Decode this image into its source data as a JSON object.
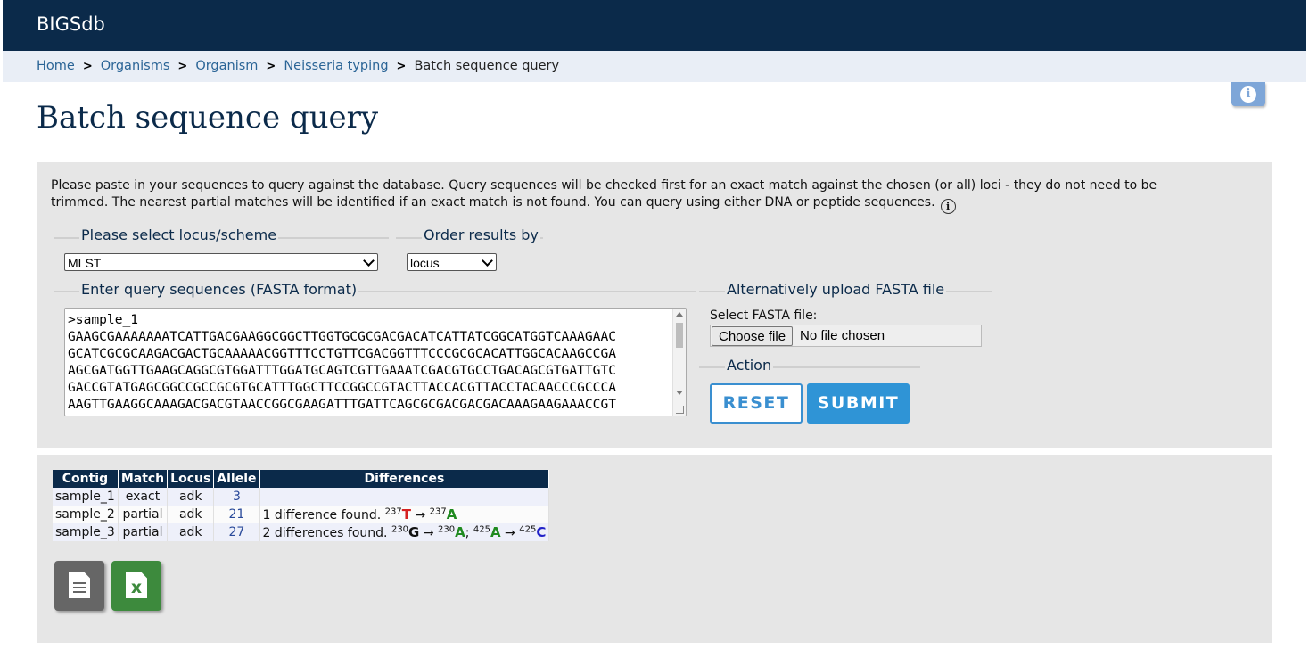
{
  "app": {
    "brand": "BIGSdb"
  },
  "breadcrumb": [
    {
      "label": "Home"
    },
    {
      "label": "Organisms"
    },
    {
      "label": "Organism"
    },
    {
      "label": "Neisseria typing"
    }
  ],
  "breadcrumb_current": "Batch sequence query",
  "breadcrumb_separator": ">",
  "page_title": "Batch sequence query",
  "intro_text": "Please paste in your sequences to query against the database. Query sequences will be checked first for an exact match against the chosen (or all) loci - they do not need to be trimmed. The nearest partial matches will be identified if an exact match is not found. You can query using either DNA or peptide sequences.",
  "locus_fieldset": {
    "legend": "Please select locus/scheme",
    "selected": "MLST"
  },
  "order_fieldset": {
    "legend": "Order results by",
    "selected": "locus"
  },
  "query_fieldset": {
    "legend": "Enter query sequences (FASTA format)",
    "text": ">sample_1\nGAAGCGAAAAAAATCATTGACGAAGGCGGCTTGGTGCGCGACGACATCATTATCGGCATGGTCAAAGAAC\nGCATCGCGCAAGACGACTGCAAAAACGGTTTCCTGTTCGACGGTTTCCCGCGCACATTGGCACAAGCCGA\nAGCGATGGTTGAAGCAGGCGTGGATTTGGATGCAGTCGTTGAAATCGACGTGCCTGACAGCGTGATTGTC\nGACCGTATGAGCGGCCGCCGCGTGCATTTGGCTTCCGGCCGTACTTACCACGTTACCTACAACCCGCCCA\nAAGTTGAAGGCAAAGACGACGTAACCGGCGAAGATTTGATTCAGCGCGACGACGACAAAGAAGAAACCGT"
  },
  "upload_fieldset": {
    "legend": "Alternatively upload FASTA file",
    "label": "Select FASTA file:",
    "button": "Choose file",
    "status": "No file chosen"
  },
  "action_fieldset": {
    "legend": "Action",
    "reset": "RESET",
    "submit": "SUBMIT"
  },
  "results": {
    "headers": [
      "Contig",
      "Match",
      "Locus",
      "Allele",
      "Differences"
    ],
    "rows": [
      {
        "contig": "sample_1",
        "match": "exact",
        "locus": "adk",
        "allele": "3",
        "diff_text": ""
      },
      {
        "contig": "sample_2",
        "match": "partial",
        "locus": "adk",
        "allele": "21",
        "diff_text": "1 difference found.",
        "diffs": [
          {
            "pos": "237",
            "from": "T",
            "to": "A"
          }
        ]
      },
      {
        "contig": "sample_3",
        "match": "partial",
        "locus": "adk",
        "allele": "27",
        "diff_text": "2 differences found.",
        "diffs": [
          {
            "pos": "230",
            "from": "G",
            "to": "A"
          },
          {
            "pos": "425",
            "from": "A",
            "to": "C"
          }
        ]
      }
    ],
    "arrow": "→",
    "diff_separator": ";"
  },
  "export": {
    "text_icon": "text-file-icon",
    "excel_icon": "excel-file-icon",
    "excel_glyph": "x"
  },
  "colors": {
    "header_bg": "#0b2a4a",
    "breadcrumb_bg": "#e9eef6",
    "panel_bg": "#e6e6e6",
    "submit": "#2f94d6",
    "base_T": "#d62020",
    "base_A": "#1f8a1f",
    "base_C": "#2020c8"
  }
}
